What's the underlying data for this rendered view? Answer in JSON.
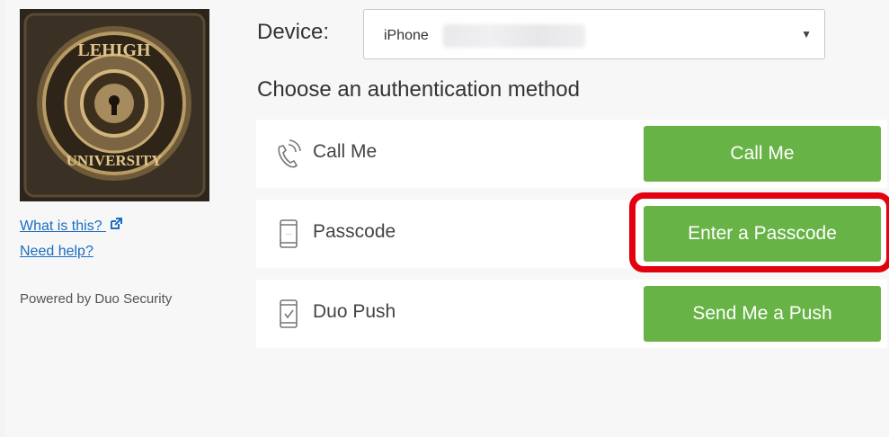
{
  "left": {
    "logo_alt": "LEHIGH UNIVERSITY",
    "links": [
      "What is this?",
      "Need help?"
    ],
    "powered_by": "Powered by Duo Security"
  },
  "device": {
    "label": "Device:",
    "selected": "iPhone"
  },
  "auth": {
    "heading": "Choose an authentication method",
    "methods": [
      {
        "label": "Call Me",
        "icon": "phone-call-icon",
        "button": "Call Me"
      },
      {
        "label": "Passcode",
        "icon": "passcode-device-icon",
        "button": "Enter a Passcode"
      },
      {
        "label": "Duo Push",
        "icon": "push-device-icon",
        "button": "Send Me a Push"
      }
    ]
  },
  "colors": {
    "button_green": "#67b346",
    "link_blue": "#1a6dc2",
    "highlight_red": "#e3000f"
  }
}
